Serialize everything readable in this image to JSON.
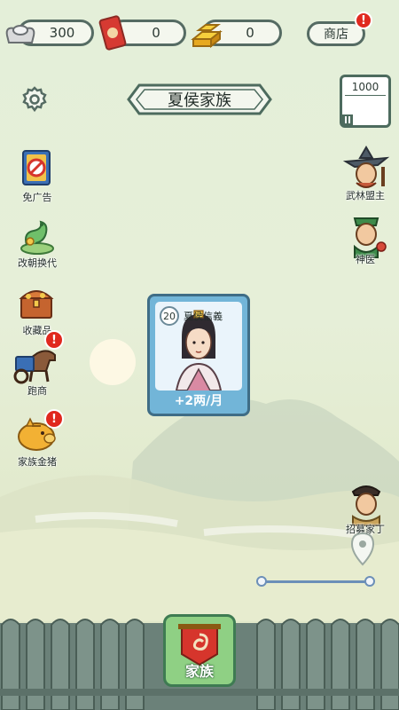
{
  "resources": {
    "silver": "300",
    "tickets": "0",
    "gold": "0"
  },
  "shop": {
    "label": "商店",
    "badge": "!"
  },
  "title": "夏侯家族",
  "counter": {
    "value": "1000"
  },
  "left_menu": [
    {
      "label": "免广告",
      "icon": "no-ads-card-icon"
    },
    {
      "label": "改朝换代",
      "icon": "jade-dragon-icon"
    },
    {
      "label": "收藏品",
      "icon": "treasure-chest-icon"
    },
    {
      "label": "跑商",
      "icon": "merchant-horse-icon",
      "badge": "!"
    },
    {
      "label": "家族金猪",
      "icon": "golden-pig-icon",
      "badge": "!"
    }
  ],
  "right_menu": [
    {
      "label": "武林盟主",
      "icon": "martial-leader-icon"
    },
    {
      "label": "神医",
      "icon": "doctor-icon"
    },
    {
      "label": "招募家丁",
      "icon": "recruit-servant-icon"
    }
  ],
  "card": {
    "level": "20",
    "name": "夏侯信義",
    "income": "+2两/月"
  },
  "bottom": {
    "family_label": "家族"
  },
  "colors": {
    "accent_green": "#8fd084",
    "card_blue": "#72b5d8",
    "badge_red": "#e0281e",
    "fence": "#6b8179"
  }
}
